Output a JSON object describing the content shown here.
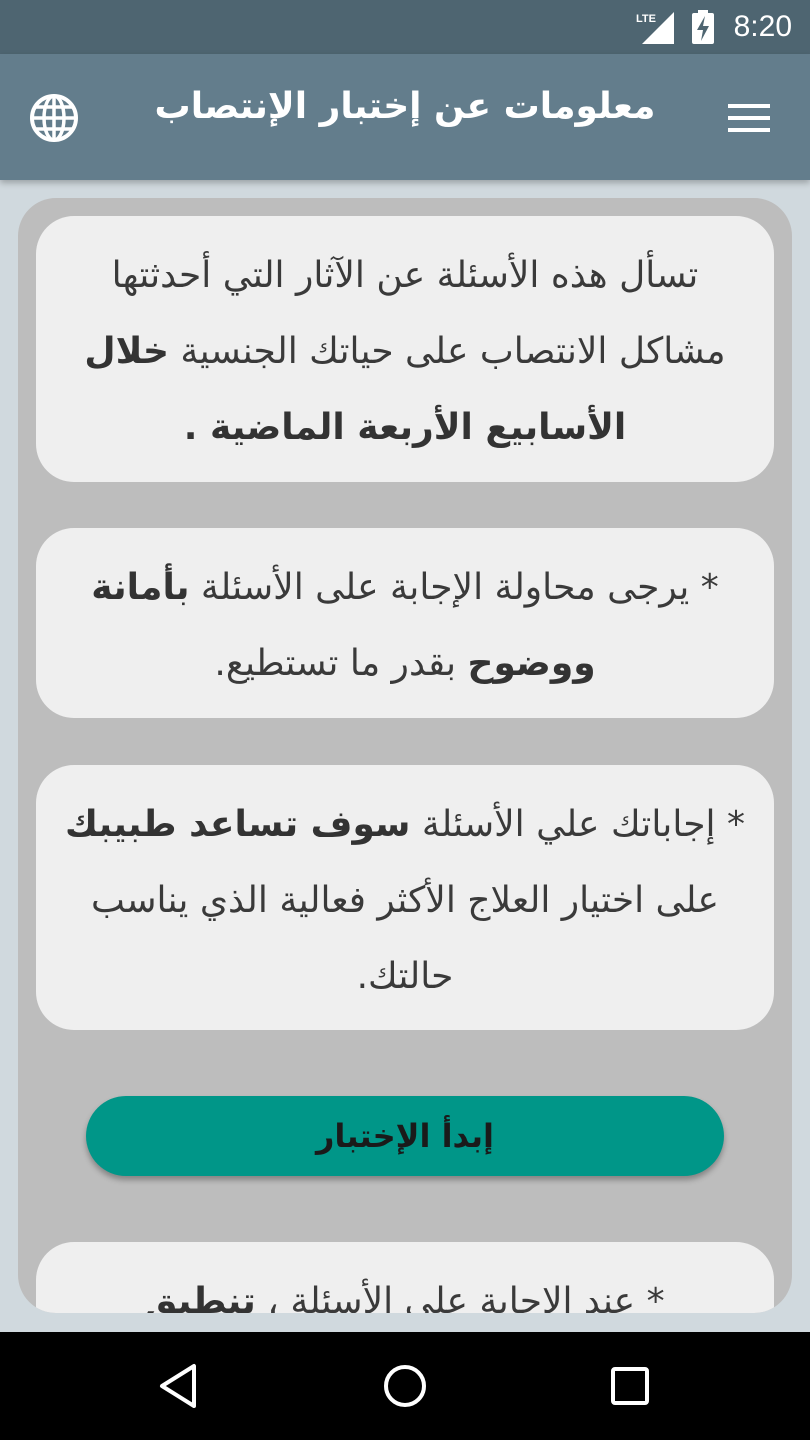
{
  "status_bar": {
    "time": "8:20",
    "network_label": "LTE",
    "icons": [
      "lte-signal-icon",
      "battery-charging-icon"
    ]
  },
  "app_bar": {
    "title": "معلومات عن إختبار الإنتصاب",
    "menu_icon": "hamburger-menu-icon",
    "language_icon": "globe-icon"
  },
  "cards": [
    {
      "text_regular": "تسأل هذه الأسئلة عن الآثار التي أحدثتها مشاكل الانتصاب على حياتك الجنسية ",
      "text_bold": "خلال الأسابيع الأربعة الماضية ."
    },
    {
      "text_regular_1": "* يرجى محاولة الإجابة على الأسئلة ",
      "text_bold": "بأمانة ووضوح",
      "text_regular_2": " بقدر ما تستطيع."
    },
    {
      "text_regular_1": "* إجاباتك علي الأسئلة ",
      "text_bold": "سوف تساعد طبيبك",
      "text_regular_2": " على اختيار العلاج الأكثر فعالية الذي يناسب حالتك."
    },
    {
      "text_regular": "* عند الإجابة على الأسئلة ، ",
      "text_bold": "تنطبق"
    }
  ],
  "start_button": {
    "label": "إبدأ الإختبار"
  },
  "nav_bar": {
    "icons": [
      "back-triangle-icon",
      "home-circle-icon",
      "recent-apps-square-icon"
    ]
  },
  "colors": {
    "status_bar": "#4e6571",
    "app_bar": "#637d8c",
    "background": "#d0d9de",
    "panel": "#bdbdbd",
    "card": "#efefef",
    "accent": "#009688"
  }
}
